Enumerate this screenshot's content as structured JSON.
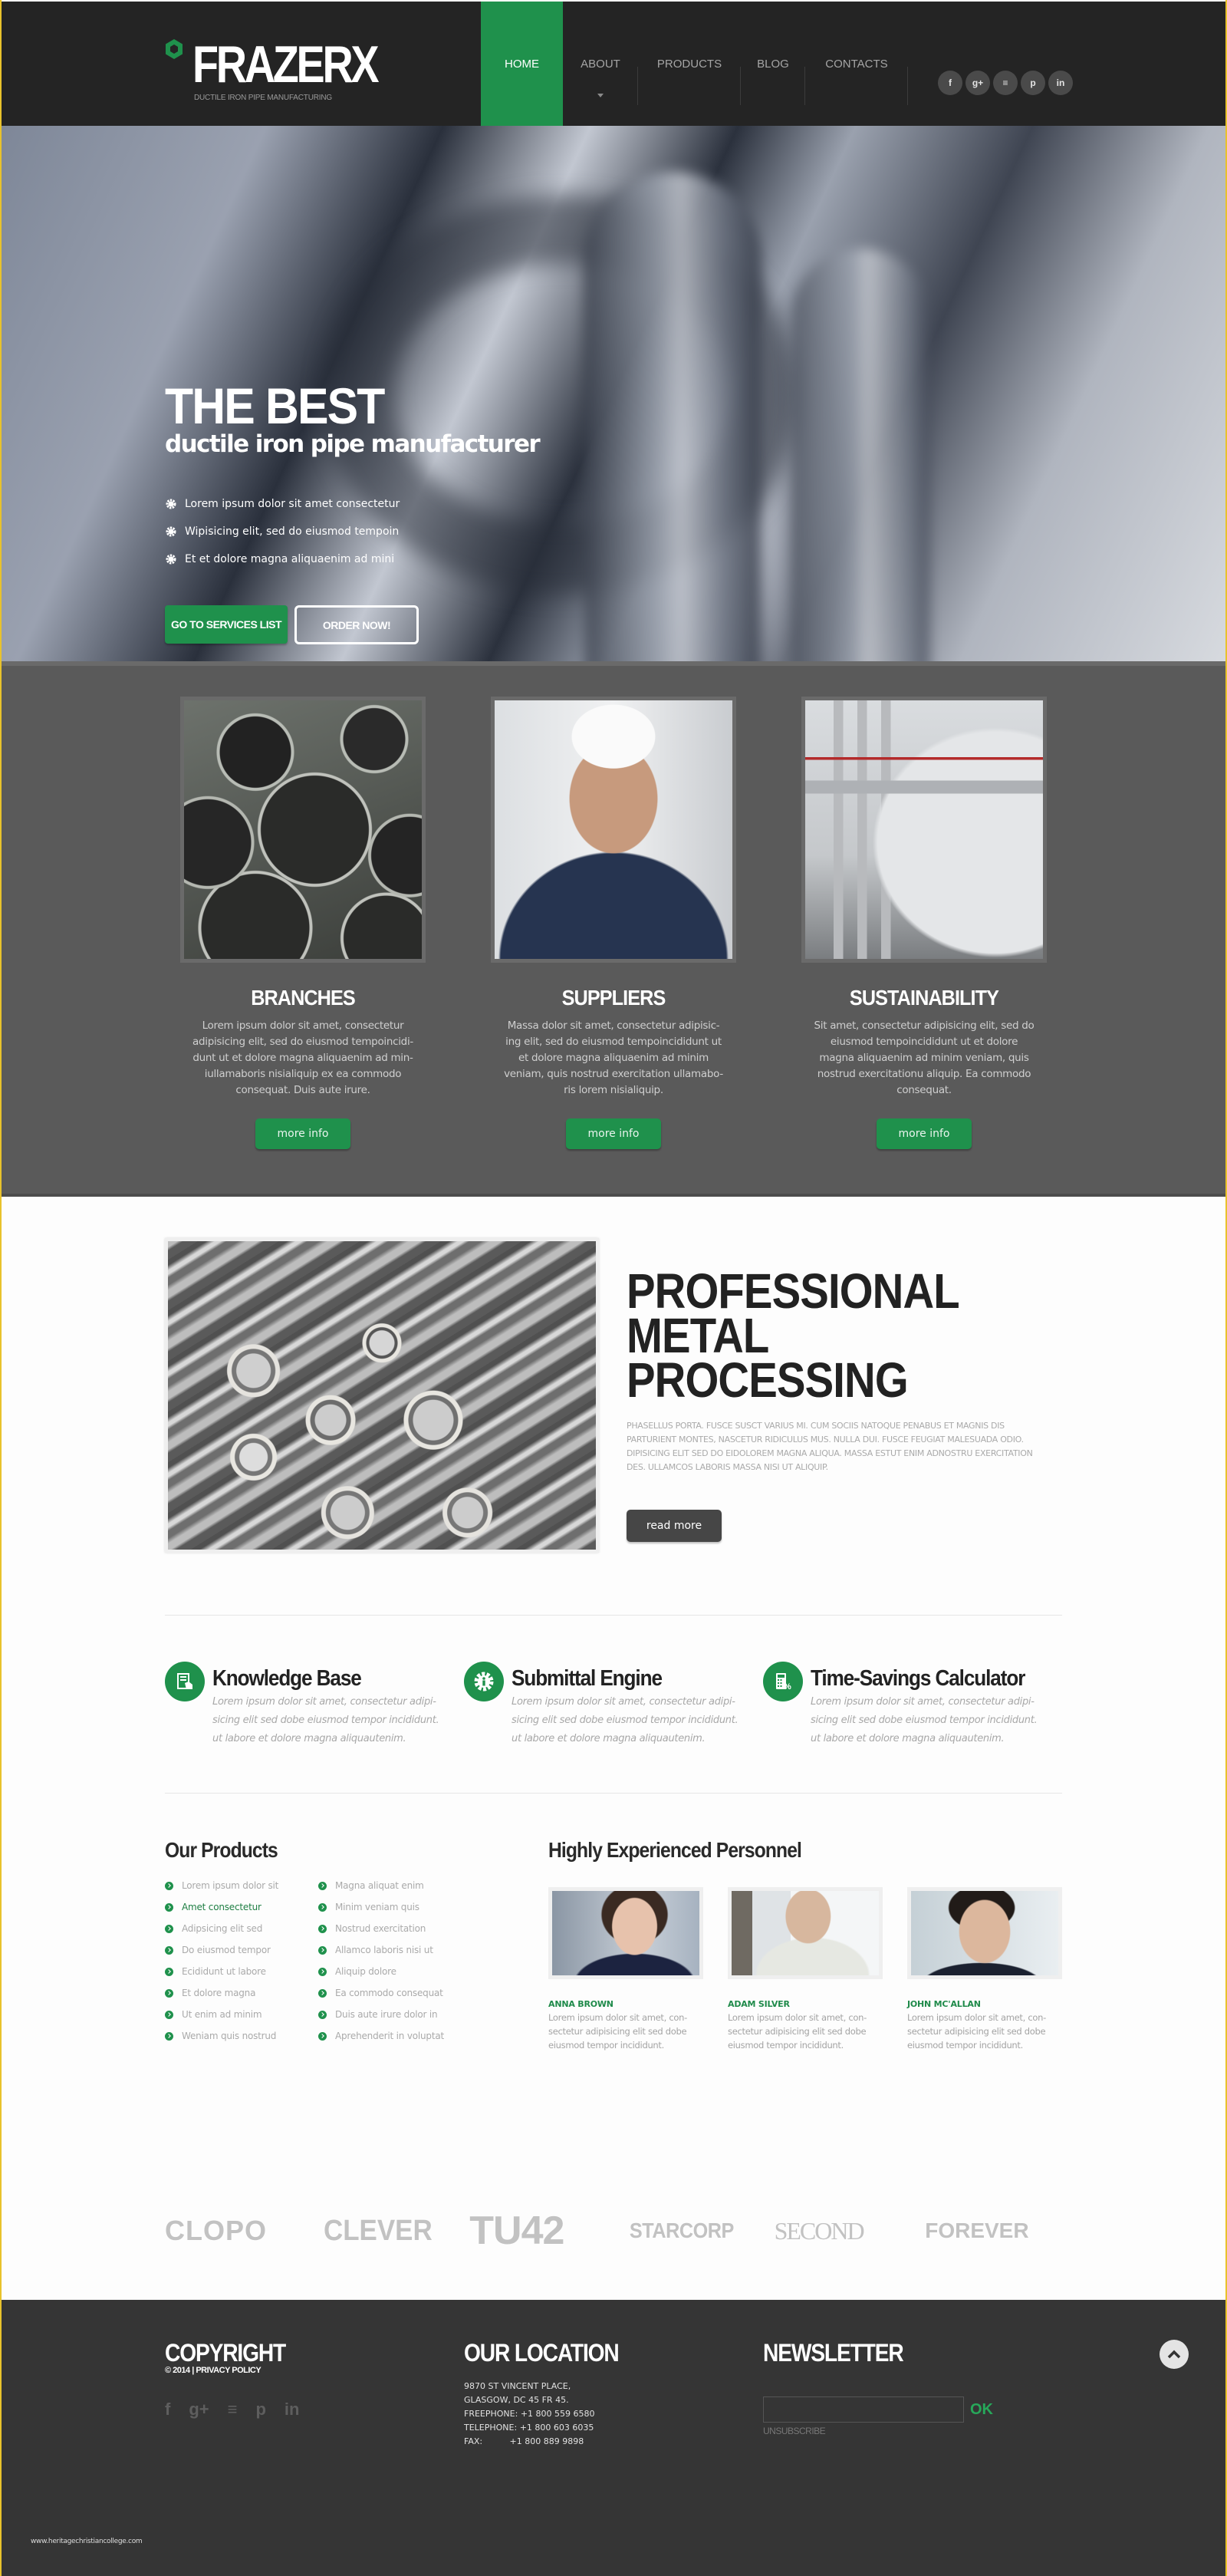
{
  "header": {
    "logo_name": "FRAZERX",
    "logo_tagline": "DUCTILE IRON PIPE MANUFACTURING",
    "nav": [
      {
        "label": "HOME",
        "active": true
      },
      {
        "label": "ABOUT",
        "has_dropdown": true
      },
      {
        "label": "PRODUCTS"
      },
      {
        "label": "BLOG"
      },
      {
        "label": "CONTACTS"
      }
    ],
    "social": [
      {
        "icon": "facebook-icon",
        "glyph": "f"
      },
      {
        "icon": "google-plus-icon",
        "glyph": "g+"
      },
      {
        "icon": "rss-icon",
        "glyph": "≡"
      },
      {
        "icon": "pinterest-icon",
        "glyph": "p"
      },
      {
        "icon": "linkedin-icon",
        "glyph": "in"
      }
    ]
  },
  "hero": {
    "title": "THE BEST",
    "subtitle": "ductile iron pipe manufacturer",
    "bullets": [
      "Lorem ipsum dolor sit amet consectetur",
      "Wipisicing elit, sed do eiusmod tempoin",
      "Et et dolore magna aliquaenim ad mini"
    ],
    "primary_button": "GO TO SERVICES LIST",
    "secondary_button": "ORDER NOW!",
    "slides_count": 3,
    "active_slide": 1
  },
  "features": [
    {
      "title": "BRANCHES",
      "text": "Lorem ipsum dolor sit amet, consectetur adipisicing elit, sed do eiusmod tempoincidi-dunt ut et dolore magna aliquaenim ad min-iullamaboris nisialiquip ex ea commodo consequat. Duis aute irure.",
      "button": "more info"
    },
    {
      "title": "SUPPLIERS",
      "text": "Massa dolor sit amet, consectetur adipisic-ing elit, sed do eiusmod tempoincididunt ut et dolore magna aliquaenim ad minim veniam, quis nostrud exercitation ullamabo-ris lorem nisialiquip.",
      "button": "more info"
    },
    {
      "title": "SUSTAINABILITY",
      "text": "Sit amet, consectetur adipisicing elit, sed do eiusmod tempoincididunt ut et dolore magna aliquaenim ad minim veniam, quis nostrud exercitationu aliquip. Ea commodo consequat.",
      "button": "more info"
    }
  ],
  "pro": {
    "title_lines": [
      "PROFESSIONAL",
      "METAL",
      "PROCESSING"
    ],
    "body": "PHASELLUS PORTA. FUSCE SUSCT VARIUS MI. CUM SOCIIS NATOQUE PENABUS ET MAGNIS DIS PARTURIENT MONTES, NASCETUR RIDICULUS MUS. NULLA DUI. FUSCE FEUGIAT MALESUADA ODIO. DIPISICING ELIT SED DO EIDOLOREM MAGNA ALIQUA. MASSA ESTUT ENIM ADNOSTRU EXERCITATION DES. ULLAMCOS LABORIS MASSA NISI UT ALIQUIP.",
    "button": "read more"
  },
  "services": [
    {
      "icon": "knowledge-base-icon",
      "title": "Knowledge Base",
      "text": "Lorem ipsum dolor sit amet, consectetur adipi-sicing elit sed dobe eiusmod tempor incididunt. ut labore et dolore magna aliquautenim."
    },
    {
      "icon": "gear-person-icon",
      "title": "Submittal Engine",
      "text": "Lorem ipsum dolor sit amet, consectetur adipi-sicing elit sed dobe eiusmod tempor incididunt. ut labore et dolore magna aliquautenim."
    },
    {
      "icon": "calculator-icon",
      "title": "Time-Savings Calculator",
      "text": "Lorem ipsum dolor sit amet, consectetur adipi-sicing elit sed dobe eiusmod tempor incididunt. ut labore et dolore magna aliquautenim."
    }
  ],
  "products": {
    "title": "Our Products",
    "col1": [
      "Lorem ipsum dolor sit",
      "Amet consectetur",
      "Adipsicing elit sed",
      "Do eiusmod tempor",
      "Ecididunt ut labore",
      "Et dolore magna",
      "Ut enim ad minim",
      "Weniam quis nostrud"
    ],
    "col2": [
      "Magna aliquat enim",
      "Minim veniam quis",
      "Nostrud exercitation",
      "Allamco laboris nisi ut",
      "Aliquip dolore",
      "Ea commodo consequat",
      "Duis aute irure dolor in",
      "Aprehenderit in voluptat"
    ],
    "highlighted": "Amet consectetur"
  },
  "personnel": {
    "title": "Highly Experienced Personnel",
    "people": [
      {
        "name": "ANNA BROWN",
        "text": "Lorem ipsum dolor sit amet, con-sectetur adipisicing elit sed dobe eiusmod tempor incididunt."
      },
      {
        "name": "ADAM SILVER",
        "text": "Lorem ipsum dolor sit amet, con-sectetur adipisicing elit sed dobe eiusmod tempor incididunt."
      },
      {
        "name": "JOHN MC'ALLAN",
        "text": "Lorem ipsum dolor sit amet, con-sectetur adipisicing elit sed dobe eiusmod tempor incididunt."
      }
    ]
  },
  "brands": [
    "CLOPO",
    "CLEVER",
    "TU42",
    "STARCORP",
    "SECOND",
    "FOREVER"
  ],
  "footer": {
    "copyright_title": "COPYRIGHT",
    "copyright_sub": "© 2014 | PRIVACY POLICY",
    "social": [
      {
        "icon": "facebook-icon",
        "glyph": "f"
      },
      {
        "icon": "google-plus-icon",
        "glyph": "g+"
      },
      {
        "icon": "rss-icon",
        "glyph": "≡"
      },
      {
        "icon": "pinterest-icon",
        "glyph": "p"
      },
      {
        "icon": "linkedin-icon",
        "glyph": "in"
      }
    ],
    "location_title": "OUR LOCATION",
    "address_lines": [
      "9870 ST VINCENT PLACE,",
      "GLASGOW, DC 45 FR 45."
    ],
    "phones": [
      {
        "label": "FREEPHONE:",
        "value": "+1 800 559 6580"
      },
      {
        "label": "TELEPHONE:",
        "value": "+1 800 603 6035"
      },
      {
        "label": "FAX:",
        "value": "+1 800 889 9898"
      }
    ],
    "newsletter_title": "NEWSLETTER",
    "newsletter_value": "",
    "newsletter_ok": "OK",
    "unsubscribe": "UNSUBSCRIBE",
    "credit": "www.heritagechristiancollege.com"
  },
  "colors": {
    "accent": "#1f914c",
    "header_bg": "#242424",
    "band_bg": "#5a5a5a",
    "footer_bg": "#353535",
    "frame": "#e8c22c"
  }
}
